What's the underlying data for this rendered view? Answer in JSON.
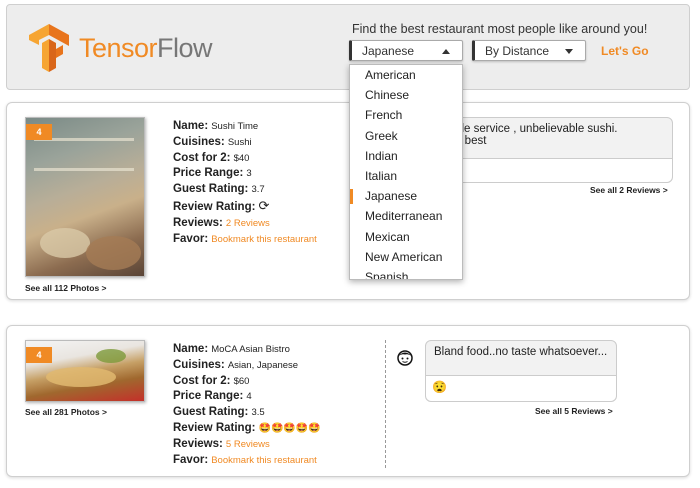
{
  "header": {
    "brand_prefix": "Tensor",
    "brand_suffix": "Flow",
    "tagline": "Find the best restaurant most people like around you!",
    "cuisine_select": "Japanese",
    "sort_select": "By Distance",
    "go_label": "Let's Go"
  },
  "cuisine_options": [
    "American",
    "Chinese",
    "French",
    "Greek",
    "Indian",
    "Italian",
    "Japanese",
    "Mediterranean",
    "Mexican",
    "New American",
    "Spanish"
  ],
  "selected_cuisine_index": 6,
  "labels": {
    "name": "Name:",
    "cuisines": "Cuisines:",
    "cost": "Cost for 2:",
    "price_range": "Price Range:",
    "guest_rating": "Guest Rating:",
    "review_rating": "Review Rating:",
    "reviews": "Reviews:",
    "favor": "Favor:"
  },
  "restaurants": [
    {
      "badge": "4",
      "see_photos": "See all 112 Photos >",
      "name": "Sushi Time",
      "cuisines": "Sushi",
      "cost": "$40",
      "price_range": "3",
      "guest_rating": "3.7",
      "review_rating_icon": "refresh-icon",
      "reviews": "2 Reviews",
      "favor": "Bookmark this restaurant",
      "review_line1": "ievable service , unbelievable sushi.",
      "review_line2": "is the best",
      "see_reviews": "See all 2 Reviews >"
    },
    {
      "badge": "4",
      "see_photos": "See all 281 Photos >",
      "name": "MoCA Asian Bistro",
      "cuisines": "Asian, Japanese",
      "cost": "$60",
      "price_range": "4",
      "guest_rating": "3.5",
      "review_rating_icon": "star-struck-emoji-icons",
      "reviews": "5 Reviews",
      "favor": "Bookmark this restaurant",
      "review_line1": "Bland food..no taste whatsoever...",
      "review_emoji": "😧",
      "see_reviews": "See all 5 Reviews >"
    }
  ],
  "colors": {
    "accent": "#f08a24",
    "header_bg": "#ededed"
  }
}
